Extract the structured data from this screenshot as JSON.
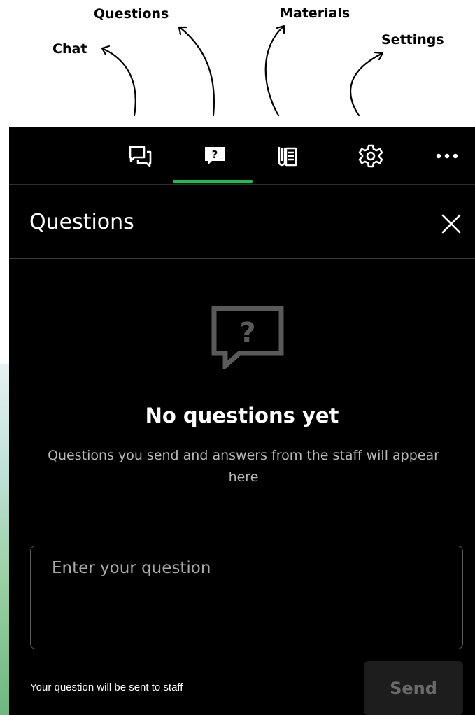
{
  "annotations": {
    "chat": "Chat",
    "questions": "Questions",
    "materials": "Materials",
    "settings": "Settings"
  },
  "tabs": [
    {
      "id": "chat",
      "icon": "chat-bubbles-icon",
      "active": false
    },
    {
      "id": "questions",
      "icon": "question-bubble-icon",
      "active": true
    },
    {
      "id": "materials",
      "icon": "materials-icon",
      "active": false
    },
    {
      "id": "settings",
      "icon": "gear-icon",
      "active": false
    },
    {
      "id": "more",
      "icon": "more-dots-icon",
      "active": false
    }
  ],
  "panel": {
    "title": "Questions",
    "empty_state": {
      "icon": "question-bubble-icon",
      "title": "No questions yet",
      "description": "Questions you send and answers from the staff will appear here"
    },
    "input": {
      "value": "",
      "placeholder": "Enter your question"
    },
    "note": "Your question will be sent to staff",
    "send_label": "Send"
  },
  "colors": {
    "panel_bg": "#000000",
    "active_tab_indicator": "#2fb35a",
    "muted_text": "#b8b8b8",
    "send_disabled_bg": "#1d1d1d",
    "send_disabled_text": "#6a6a6a"
  }
}
